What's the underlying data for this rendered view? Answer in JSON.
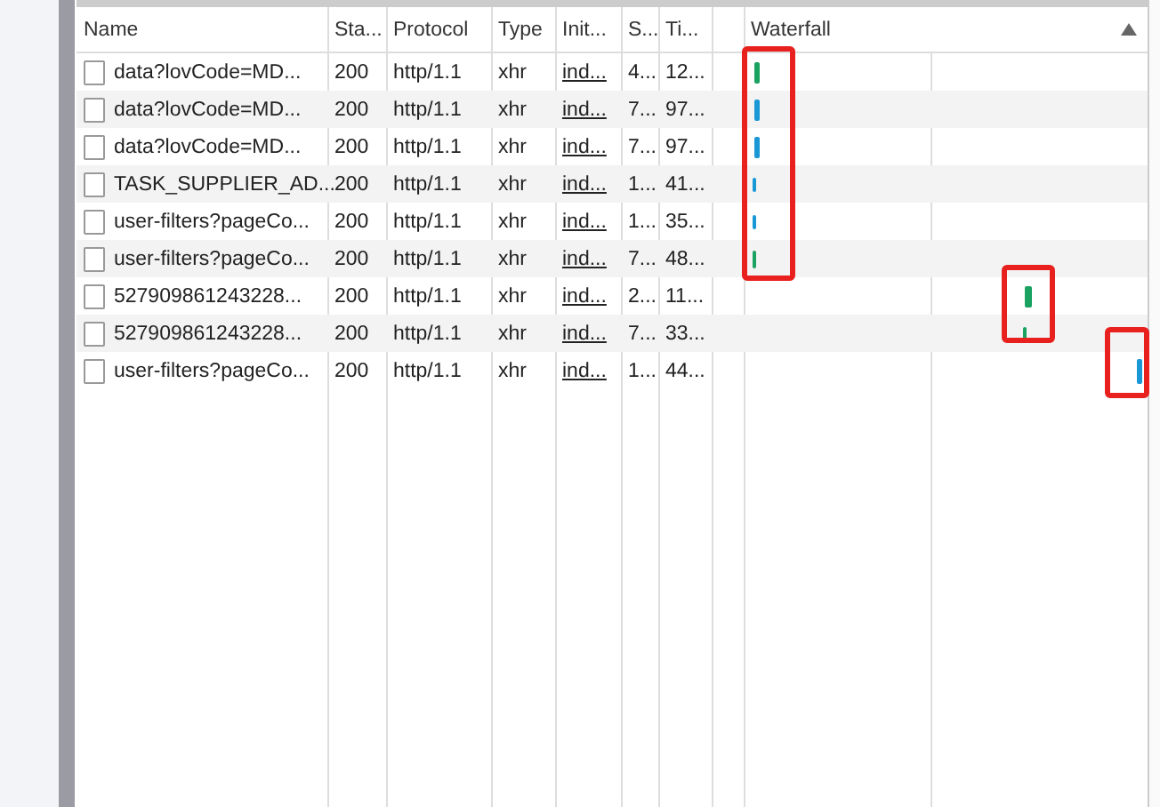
{
  "table": {
    "columns": [
      {
        "label": "Name",
        "sorted": false
      },
      {
        "label": "Sta...",
        "sorted": false
      },
      {
        "label": "Protocol",
        "sorted": false
      },
      {
        "label": "Type",
        "sorted": false
      },
      {
        "label": "Init...",
        "sorted": false
      },
      {
        "label": "S...",
        "sorted": false
      },
      {
        "label": "Ti...",
        "sorted": false
      },
      {
        "sorted": false
      },
      {
        "label": "Waterfall",
        "sorted": true
      }
    ],
    "rows": [
      {
        "name": "data?lovCode=MD...",
        "status": "200",
        "protocol": "http/1.1",
        "type": "xhr",
        "initiator": "ind...",
        "size": "4...",
        "time": "12..."
      },
      {
        "name": "data?lovCode=MD...",
        "status": "200",
        "protocol": "http/1.1",
        "type": "xhr",
        "initiator": "ind...",
        "size": "7...",
        "time": "97..."
      },
      {
        "name": "data?lovCode=MD...",
        "status": "200",
        "protocol": "http/1.1",
        "type": "xhr",
        "initiator": "ind...",
        "size": "7...",
        "time": "97..."
      },
      {
        "name": "TASK_SUPPLIER_AD...",
        "status": "200",
        "protocol": "http/1.1",
        "type": "xhr",
        "initiator": "ind...",
        "size": "1...",
        "time": "41..."
      },
      {
        "name": "user-filters?pageCo...",
        "status": "200",
        "protocol": "http/1.1",
        "type": "xhr",
        "initiator": "ind...",
        "size": "1...",
        "time": "35..."
      },
      {
        "name": "user-filters?pageCo...",
        "status": "200",
        "protocol": "http/1.1",
        "type": "xhr",
        "initiator": "ind...",
        "size": "7...",
        "time": "48..."
      },
      {
        "name": "527909861243228...",
        "status": "200",
        "protocol": "http/1.1",
        "type": "xhr",
        "initiator": "ind...",
        "size": "2...",
        "time": "11..."
      },
      {
        "name": "527909861243228...",
        "status": "200",
        "protocol": "http/1.1",
        "type": "xhr",
        "initiator": "ind...",
        "size": "7...",
        "time": "33..."
      },
      {
        "name": "user-filters?pageCo...",
        "status": "200",
        "protocol": "http/1.1",
        "type": "xhr",
        "initiator": "ind...",
        "size": "1...",
        "time": "44..."
      }
    ]
  }
}
